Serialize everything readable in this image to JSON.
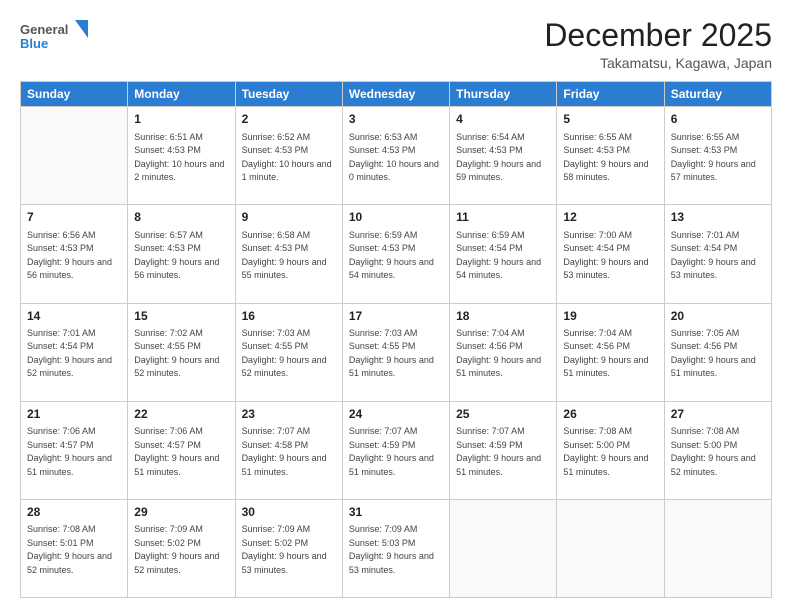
{
  "logo": {
    "general": "General",
    "blue": "Blue"
  },
  "header": {
    "month": "December 2025",
    "location": "Takamatsu, Kagawa, Japan"
  },
  "weekdays": [
    "Sunday",
    "Monday",
    "Tuesday",
    "Wednesday",
    "Thursday",
    "Friday",
    "Saturday"
  ],
  "weeks": [
    [
      {
        "day": "",
        "sunrise": "",
        "sunset": "",
        "daylight": ""
      },
      {
        "day": "1",
        "sunrise": "Sunrise: 6:51 AM",
        "sunset": "Sunset: 4:53 PM",
        "daylight": "Daylight: 10 hours and 2 minutes."
      },
      {
        "day": "2",
        "sunrise": "Sunrise: 6:52 AM",
        "sunset": "Sunset: 4:53 PM",
        "daylight": "Daylight: 10 hours and 1 minute."
      },
      {
        "day": "3",
        "sunrise": "Sunrise: 6:53 AM",
        "sunset": "Sunset: 4:53 PM",
        "daylight": "Daylight: 10 hours and 0 minutes."
      },
      {
        "day": "4",
        "sunrise": "Sunrise: 6:54 AM",
        "sunset": "Sunset: 4:53 PM",
        "daylight": "Daylight: 9 hours and 59 minutes."
      },
      {
        "day": "5",
        "sunrise": "Sunrise: 6:55 AM",
        "sunset": "Sunset: 4:53 PM",
        "daylight": "Daylight: 9 hours and 58 minutes."
      },
      {
        "day": "6",
        "sunrise": "Sunrise: 6:55 AM",
        "sunset": "Sunset: 4:53 PM",
        "daylight": "Daylight: 9 hours and 57 minutes."
      }
    ],
    [
      {
        "day": "7",
        "sunrise": "Sunrise: 6:56 AM",
        "sunset": "Sunset: 4:53 PM",
        "daylight": "Daylight: 9 hours and 56 minutes."
      },
      {
        "day": "8",
        "sunrise": "Sunrise: 6:57 AM",
        "sunset": "Sunset: 4:53 PM",
        "daylight": "Daylight: 9 hours and 56 minutes."
      },
      {
        "day": "9",
        "sunrise": "Sunrise: 6:58 AM",
        "sunset": "Sunset: 4:53 PM",
        "daylight": "Daylight: 9 hours and 55 minutes."
      },
      {
        "day": "10",
        "sunrise": "Sunrise: 6:59 AM",
        "sunset": "Sunset: 4:53 PM",
        "daylight": "Daylight: 9 hours and 54 minutes."
      },
      {
        "day": "11",
        "sunrise": "Sunrise: 6:59 AM",
        "sunset": "Sunset: 4:54 PM",
        "daylight": "Daylight: 9 hours and 54 minutes."
      },
      {
        "day": "12",
        "sunrise": "Sunrise: 7:00 AM",
        "sunset": "Sunset: 4:54 PM",
        "daylight": "Daylight: 9 hours and 53 minutes."
      },
      {
        "day": "13",
        "sunrise": "Sunrise: 7:01 AM",
        "sunset": "Sunset: 4:54 PM",
        "daylight": "Daylight: 9 hours and 53 minutes."
      }
    ],
    [
      {
        "day": "14",
        "sunrise": "Sunrise: 7:01 AM",
        "sunset": "Sunset: 4:54 PM",
        "daylight": "Daylight: 9 hours and 52 minutes."
      },
      {
        "day": "15",
        "sunrise": "Sunrise: 7:02 AM",
        "sunset": "Sunset: 4:55 PM",
        "daylight": "Daylight: 9 hours and 52 minutes."
      },
      {
        "day": "16",
        "sunrise": "Sunrise: 7:03 AM",
        "sunset": "Sunset: 4:55 PM",
        "daylight": "Daylight: 9 hours and 52 minutes."
      },
      {
        "day": "17",
        "sunrise": "Sunrise: 7:03 AM",
        "sunset": "Sunset: 4:55 PM",
        "daylight": "Daylight: 9 hours and 51 minutes."
      },
      {
        "day": "18",
        "sunrise": "Sunrise: 7:04 AM",
        "sunset": "Sunset: 4:56 PM",
        "daylight": "Daylight: 9 hours and 51 minutes."
      },
      {
        "day": "19",
        "sunrise": "Sunrise: 7:04 AM",
        "sunset": "Sunset: 4:56 PM",
        "daylight": "Daylight: 9 hours and 51 minutes."
      },
      {
        "day": "20",
        "sunrise": "Sunrise: 7:05 AM",
        "sunset": "Sunset: 4:56 PM",
        "daylight": "Daylight: 9 hours and 51 minutes."
      }
    ],
    [
      {
        "day": "21",
        "sunrise": "Sunrise: 7:06 AM",
        "sunset": "Sunset: 4:57 PM",
        "daylight": "Daylight: 9 hours and 51 minutes."
      },
      {
        "day": "22",
        "sunrise": "Sunrise: 7:06 AM",
        "sunset": "Sunset: 4:57 PM",
        "daylight": "Daylight: 9 hours and 51 minutes."
      },
      {
        "day": "23",
        "sunrise": "Sunrise: 7:07 AM",
        "sunset": "Sunset: 4:58 PM",
        "daylight": "Daylight: 9 hours and 51 minutes."
      },
      {
        "day": "24",
        "sunrise": "Sunrise: 7:07 AM",
        "sunset": "Sunset: 4:59 PM",
        "daylight": "Daylight: 9 hours and 51 minutes."
      },
      {
        "day": "25",
        "sunrise": "Sunrise: 7:07 AM",
        "sunset": "Sunset: 4:59 PM",
        "daylight": "Daylight: 9 hours and 51 minutes."
      },
      {
        "day": "26",
        "sunrise": "Sunrise: 7:08 AM",
        "sunset": "Sunset: 5:00 PM",
        "daylight": "Daylight: 9 hours and 51 minutes."
      },
      {
        "day": "27",
        "sunrise": "Sunrise: 7:08 AM",
        "sunset": "Sunset: 5:00 PM",
        "daylight": "Daylight: 9 hours and 52 minutes."
      }
    ],
    [
      {
        "day": "28",
        "sunrise": "Sunrise: 7:08 AM",
        "sunset": "Sunset: 5:01 PM",
        "daylight": "Daylight: 9 hours and 52 minutes."
      },
      {
        "day": "29",
        "sunrise": "Sunrise: 7:09 AM",
        "sunset": "Sunset: 5:02 PM",
        "daylight": "Daylight: 9 hours and 52 minutes."
      },
      {
        "day": "30",
        "sunrise": "Sunrise: 7:09 AM",
        "sunset": "Sunset: 5:02 PM",
        "daylight": "Daylight: 9 hours and 53 minutes."
      },
      {
        "day": "31",
        "sunrise": "Sunrise: 7:09 AM",
        "sunset": "Sunset: 5:03 PM",
        "daylight": "Daylight: 9 hours and 53 minutes."
      },
      {
        "day": "",
        "sunrise": "",
        "sunset": "",
        "daylight": ""
      },
      {
        "day": "",
        "sunrise": "",
        "sunset": "",
        "daylight": ""
      },
      {
        "day": "",
        "sunrise": "",
        "sunset": "",
        "daylight": ""
      }
    ]
  ]
}
